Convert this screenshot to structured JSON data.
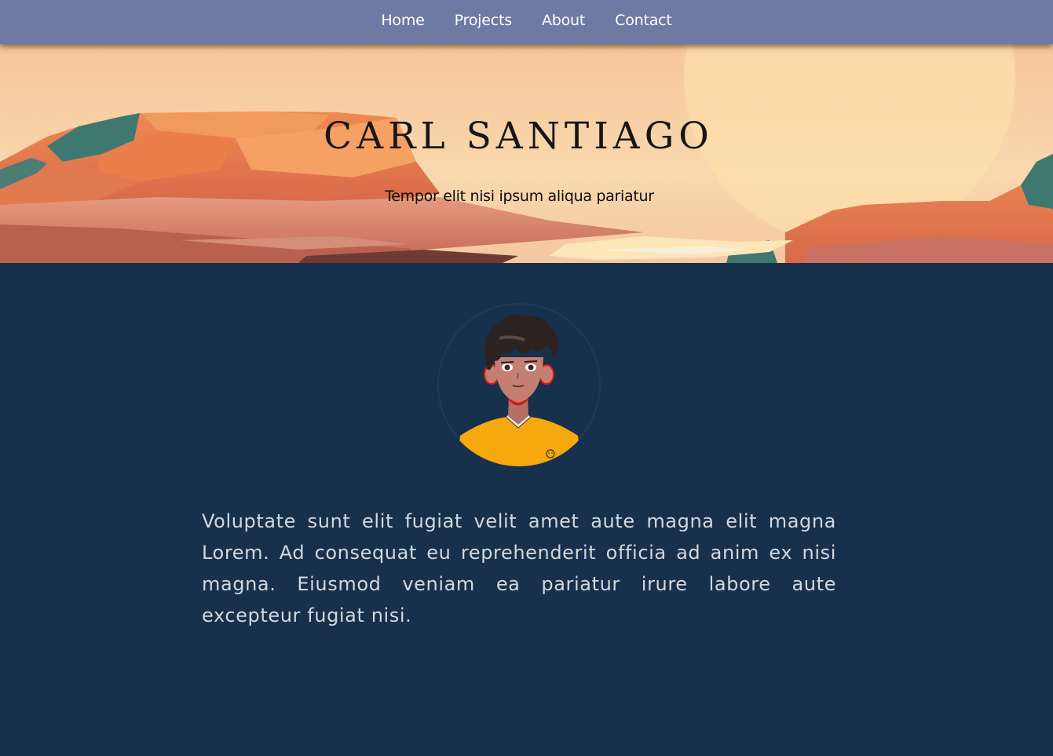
{
  "nav": {
    "items": [
      {
        "label": "Home"
      },
      {
        "label": "Projects"
      },
      {
        "label": "About"
      },
      {
        "label": "Contact"
      }
    ]
  },
  "hero": {
    "title": "CARL SANTIAGO",
    "subtitle": "Tempor elit nisi ipsum aliqua pariatur"
  },
  "about": {
    "avatar_icon": "cartoon-avatar",
    "bio": "Voluptate sunt elit fugiat velit amet aute magna elit magna Lorem. Ad consequat eu reprehenderit officia ad anim ex nisi magna. Eiusmod veniam ea pariatur irure labore aute excepteur fugiat nisi."
  },
  "colors": {
    "navbar": "#6e79a4",
    "page_background": "#17304c",
    "bio_text": "#d3d8de",
    "shirt": "#f6a80f"
  }
}
